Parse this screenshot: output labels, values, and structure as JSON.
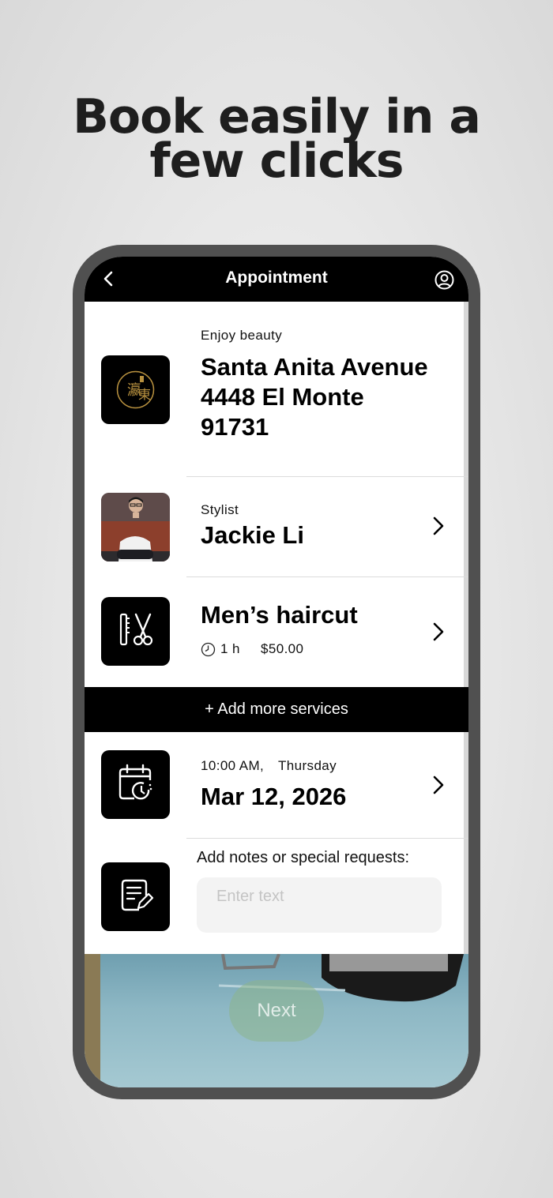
{
  "promo": {
    "headline_line1": "Book easily in a",
    "headline_line2": "few clicks"
  },
  "header": {
    "title": "Appointment",
    "back_icon": "chevron-left-icon",
    "profile_icon": "user-circle-icon"
  },
  "salon": {
    "name": "Enjoy beauty",
    "address_line1": "Santa Anita Avenue",
    "address_line2": "4448 El Monte",
    "address_line3": "91731"
  },
  "stylist": {
    "label": "Stylist",
    "name": "Jackie Li"
  },
  "service": {
    "name": "Men’s haircut",
    "duration": "1 h",
    "price": "$50.00",
    "icon": "comb-scissors-icon"
  },
  "add_services_label": "+ Add more services",
  "schedule": {
    "time": "10:00 AM,",
    "weekday": "Thursday",
    "date": "Mar 12, 2026",
    "icon": "calendar-clock-icon"
  },
  "notes": {
    "label": "Add notes or special requests:",
    "placeholder": "Enter text",
    "value": "",
    "icon": "note-edit-icon"
  },
  "next_button_label": "Next",
  "colors": {
    "bar": "#000000",
    "logo_gold": "#b8913f",
    "next_button": "#8cb48c"
  }
}
